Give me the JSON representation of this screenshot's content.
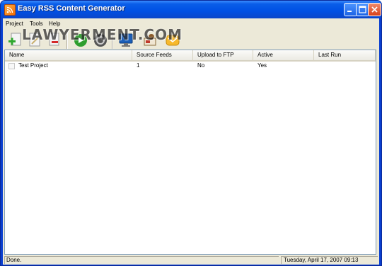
{
  "window": {
    "title": "Easy RSS Content Generator"
  },
  "menu": [
    {
      "label": "Project"
    },
    {
      "label": "Tools"
    },
    {
      "label": "Help"
    }
  ],
  "toolbar": {
    "buttons": [
      {
        "icon": "add-icon"
      },
      {
        "icon": "edit-icon"
      },
      {
        "icon": "delete-icon"
      },
      {
        "icon": "run-icon"
      },
      {
        "icon": "stop-icon"
      },
      {
        "icon": "monitor-icon"
      },
      {
        "icon": "settings-icon"
      },
      {
        "icon": "mail-icon"
      }
    ]
  },
  "list": {
    "columns": [
      "Name",
      "Source Feeds",
      "Upload to FTP",
      "Active",
      "Last Run"
    ],
    "rows": [
      {
        "name": "Test Project",
        "source_feeds": "1",
        "upload_to_ftp": "No",
        "active": "Yes",
        "last_run": ""
      }
    ]
  },
  "status": {
    "left": "Done.",
    "right": "Tuesday, April 17, 2007 09:13"
  },
  "watermark": "LAWYERMENT.COM",
  "colors": {
    "titlebar": "#0050e4",
    "client": "#ece9d8",
    "border": "#7f9db9"
  }
}
